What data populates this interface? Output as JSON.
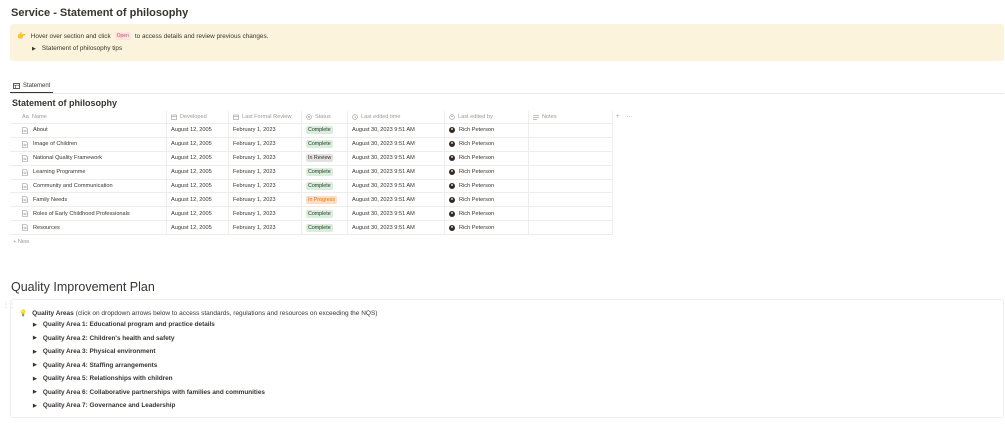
{
  "page": {
    "title": "Service - Statement of philosophy"
  },
  "callout": {
    "emoji": "👉",
    "text_before": "Hover over section and click",
    "badge": "Open",
    "text_after": "to access details and review previous changes.",
    "toggle_label": "Statement of philosophy tips"
  },
  "view": {
    "tab_label": "Statement"
  },
  "database": {
    "title": "Statement of philosophy",
    "columns": [
      "Name",
      "Developed",
      "Last Formal Review",
      "Status",
      "Last edited time",
      "Last edited by",
      "Notes"
    ],
    "rows": [
      {
        "name": "About",
        "developed": "August 12, 2005",
        "review": "February 1, 2023",
        "status": "Complete",
        "edited": "August 30, 2023 9:51 AM",
        "by": "Rich Peterson",
        "notes": ""
      },
      {
        "name": "Image of Children",
        "developed": "August 12, 2005",
        "review": "February 1, 2023",
        "status": "Complete",
        "edited": "August 30, 2023 9:51 AM",
        "by": "Rich Peterson",
        "notes": ""
      },
      {
        "name": "National Quality Framework",
        "developed": "August 12, 2005",
        "review": "February 1, 2023",
        "status": "In Review",
        "edited": "August 30, 2023 9:51 AM",
        "by": "Rich Peterson",
        "notes": ""
      },
      {
        "name": "Learning Programme",
        "developed": "August 12, 2005",
        "review": "February 1, 2023",
        "status": "Complete",
        "edited": "August 30, 2023 9:51 AM",
        "by": "Rich Peterson",
        "notes": ""
      },
      {
        "name": "Community and Communication",
        "developed": "August 12, 2005",
        "review": "February 1, 2023",
        "status": "Complete",
        "edited": "August 30, 2023 9:51 AM",
        "by": "Rich Peterson",
        "notes": ""
      },
      {
        "name": "Family Needs",
        "developed": "August 12, 2005",
        "review": "February 1, 2023",
        "status": "In Progress",
        "edited": "August 30, 2023 9:51 AM",
        "by": "Rich Peterson",
        "notes": ""
      },
      {
        "name": "Roles of Early Childhood Professionals",
        "developed": "August 12, 2005",
        "review": "February 1, 2023",
        "status": "Complete",
        "edited": "August 30, 2023 9:51 AM",
        "by": "Rich Peterson",
        "notes": ""
      },
      {
        "name": "Resources",
        "developed": "August 12, 2005",
        "review": "February 1, 2023",
        "status": "Complete",
        "edited": "August 30, 2023 9:51 AM",
        "by": "Rich Peterson",
        "notes": ""
      }
    ],
    "new_label": "+ New",
    "add_column": "+",
    "more": "···"
  },
  "status_colors": {
    "Complete": {
      "bg": "#dbeddb",
      "fg": "#1c3829"
    },
    "In Review": {
      "bg": "#e3e2e0",
      "fg": "#32302c"
    },
    "In Progress": {
      "bg": "#fadec9",
      "fg": "#d9730d"
    }
  },
  "qip": {
    "title": "Quality Improvement Plan",
    "heading_emoji": "💡",
    "heading_bold": "Quality Areas",
    "heading_rest": "(click on dropdown arrows below to access standards, regulations and resources on exceeding the NQS)",
    "areas": [
      "Quality Area 1: Educational program and practice details",
      "Quality Area 2: Children's health and safety",
      "Quality Area 3: Physical environment",
      "Quality Area 4: Staffing arrangements",
      "Quality Area 5: Relationships with children",
      "Quality Area 6: Collaborative partnerships with families and communities",
      "Quality Area 7: Governance and Leadership"
    ]
  },
  "icons": {
    "name_col": "text-type-icon",
    "date_col": "calendar-icon",
    "status_col": "status-icon",
    "time_col": "clock-icon",
    "person_col": "person-icon",
    "notes_col": "text-lines-icon",
    "page": "page-icon",
    "toggle": "triangle-right-icon"
  }
}
